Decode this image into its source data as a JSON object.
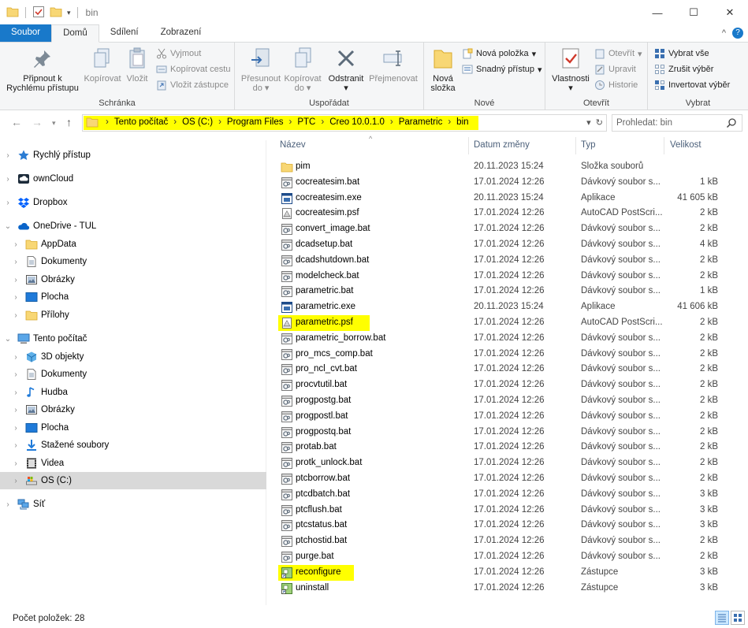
{
  "window": {
    "title": "bin"
  },
  "ribbon_tabs": [
    "Soubor",
    "Domů",
    "Sdílení",
    "Zobrazení"
  ],
  "ribbon": {
    "clipboard": {
      "label": "Schránka",
      "pin": "Připnout k Rychlému přístupu",
      "copy": "Kopírovat",
      "paste": "Vložit",
      "cut": "Vyjmout",
      "copy_path": "Kopírovat cestu",
      "paste_shortcut": "Vložit zástupce"
    },
    "organize": {
      "label": "Uspořádat",
      "move_to": "Přesunout do",
      "copy_to": "Kopírovat do",
      "delete": "Odstranit",
      "rename": "Přejmenovat"
    },
    "new": {
      "label": "Nové",
      "new_folder": "Nová složka",
      "new_item": "Nová položka",
      "easy_access": "Snadný přístup"
    },
    "open": {
      "label": "Otevřít",
      "properties": "Vlastnosti",
      "open": "Otevřít",
      "edit": "Upravit",
      "history": "Historie"
    },
    "select": {
      "label": "Vybrat",
      "select_all": "Vybrat vše",
      "select_none": "Zrušit výběr",
      "invert": "Invertovat výběr"
    }
  },
  "address": {
    "crumbs": [
      "Tento počítač",
      "OS (C:)",
      "Program Files",
      "PTC",
      "Creo 10.0.1.0",
      "Parametric",
      "bin"
    ],
    "search_placeholder": "Prohledat: bin"
  },
  "nav": [
    {
      "label": "Rychlý přístup",
      "icon": "star-icon",
      "indent": 0
    },
    {
      "label": "ownCloud",
      "icon": "cloud-icon",
      "indent": 0
    },
    {
      "label": "Dropbox",
      "icon": "dropbox-icon",
      "indent": 0
    },
    {
      "label": "OneDrive - TUL",
      "icon": "onedrive-icon",
      "indent": 0
    },
    {
      "label": "AppData",
      "icon": "folder-icon",
      "indent": 1
    },
    {
      "label": "Dokumenty",
      "icon": "document-icon",
      "indent": 1
    },
    {
      "label": "Obrázky",
      "icon": "pictures-icon",
      "indent": 1
    },
    {
      "label": "Plocha",
      "icon": "desktop-icon",
      "indent": 1
    },
    {
      "label": "Přílohy",
      "icon": "folder-icon",
      "indent": 1
    },
    {
      "label": "Tento počítač",
      "icon": "computer-icon",
      "indent": 0
    },
    {
      "label": "3D objekty",
      "icon": "cube-icon",
      "indent": 1
    },
    {
      "label": "Dokumenty",
      "icon": "document-icon",
      "indent": 1
    },
    {
      "label": "Hudba",
      "icon": "music-icon",
      "indent": 1
    },
    {
      "label": "Obrázky",
      "icon": "pictures-icon",
      "indent": 1
    },
    {
      "label": "Plocha",
      "icon": "desktop-icon",
      "indent": 1
    },
    {
      "label": "Stažené soubory",
      "icon": "download-icon",
      "indent": 1
    },
    {
      "label": "Videa",
      "icon": "video-icon",
      "indent": 1
    },
    {
      "label": "OS (C:)",
      "icon": "drive-icon",
      "indent": 1
    },
    {
      "label": "Síť",
      "icon": "network-icon",
      "indent": 0
    }
  ],
  "columns": {
    "name": "Název",
    "date": "Datum změny",
    "type": "Typ",
    "size": "Velikost"
  },
  "files": [
    {
      "name": "pim",
      "date": "20.11.2023 15:24",
      "type": "Složka souborů",
      "size": "",
      "icon": "folder-icon"
    },
    {
      "name": "cocreatesim.bat",
      "date": "17.01.2024 12:26",
      "type": "Dávkový soubor s...",
      "size": "1 kB",
      "icon": "bat-icon"
    },
    {
      "name": "cocreatesim.exe",
      "date": "20.11.2023 15:24",
      "type": "Aplikace",
      "size": "41 605 kB",
      "icon": "exe-icon"
    },
    {
      "name": "cocreatesim.psf",
      "date": "17.01.2024 12:26",
      "type": "AutoCAD PostScri...",
      "size": "2 kB",
      "icon": "psf-icon"
    },
    {
      "name": "convert_image.bat",
      "date": "17.01.2024 12:26",
      "type": "Dávkový soubor s...",
      "size": "2 kB",
      "icon": "bat-icon"
    },
    {
      "name": "dcadsetup.bat",
      "date": "17.01.2024 12:26",
      "type": "Dávkový soubor s...",
      "size": "4 kB",
      "icon": "bat-icon"
    },
    {
      "name": "dcadshutdown.bat",
      "date": "17.01.2024 12:26",
      "type": "Dávkový soubor s...",
      "size": "2 kB",
      "icon": "bat-icon"
    },
    {
      "name": "modelcheck.bat",
      "date": "17.01.2024 12:26",
      "type": "Dávkový soubor s...",
      "size": "2 kB",
      "icon": "bat-icon"
    },
    {
      "name": "parametric.bat",
      "date": "17.01.2024 12:26",
      "type": "Dávkový soubor s...",
      "size": "1 kB",
      "icon": "bat-icon"
    },
    {
      "name": "parametric.exe",
      "date": "20.11.2023 15:24",
      "type": "Aplikace",
      "size": "41 606 kB",
      "icon": "exe-icon"
    },
    {
      "name": "parametric.psf",
      "date": "17.01.2024 12:26",
      "type": "AutoCAD PostScri...",
      "size": "2 kB",
      "icon": "psf-icon",
      "highlight": true
    },
    {
      "name": "parametric_borrow.bat",
      "date": "17.01.2024 12:26",
      "type": "Dávkový soubor s...",
      "size": "2 kB",
      "icon": "bat-icon"
    },
    {
      "name": "pro_mcs_comp.bat",
      "date": "17.01.2024 12:26",
      "type": "Dávkový soubor s...",
      "size": "2 kB",
      "icon": "bat-icon"
    },
    {
      "name": "pro_ncl_cvt.bat",
      "date": "17.01.2024 12:26",
      "type": "Dávkový soubor s...",
      "size": "2 kB",
      "icon": "bat-icon"
    },
    {
      "name": "procvtutil.bat",
      "date": "17.01.2024 12:26",
      "type": "Dávkový soubor s...",
      "size": "2 kB",
      "icon": "bat-icon"
    },
    {
      "name": "progpostg.bat",
      "date": "17.01.2024 12:26",
      "type": "Dávkový soubor s...",
      "size": "2 kB",
      "icon": "bat-icon"
    },
    {
      "name": "progpostl.bat",
      "date": "17.01.2024 12:26",
      "type": "Dávkový soubor s...",
      "size": "2 kB",
      "icon": "bat-icon"
    },
    {
      "name": "progpostq.bat",
      "date": "17.01.2024 12:26",
      "type": "Dávkový soubor s...",
      "size": "2 kB",
      "icon": "bat-icon"
    },
    {
      "name": "protab.bat",
      "date": "17.01.2024 12:26",
      "type": "Dávkový soubor s...",
      "size": "2 kB",
      "icon": "bat-icon"
    },
    {
      "name": "protk_unlock.bat",
      "date": "17.01.2024 12:26",
      "type": "Dávkový soubor s...",
      "size": "2 kB",
      "icon": "bat-icon"
    },
    {
      "name": "ptcborrow.bat",
      "date": "17.01.2024 12:26",
      "type": "Dávkový soubor s...",
      "size": "2 kB",
      "icon": "bat-icon"
    },
    {
      "name": "ptcdbatch.bat",
      "date": "17.01.2024 12:26",
      "type": "Dávkový soubor s...",
      "size": "3 kB",
      "icon": "bat-icon"
    },
    {
      "name": "ptcflush.bat",
      "date": "17.01.2024 12:26",
      "type": "Dávkový soubor s...",
      "size": "3 kB",
      "icon": "bat-icon"
    },
    {
      "name": "ptcstatus.bat",
      "date": "17.01.2024 12:26",
      "type": "Dávkový soubor s...",
      "size": "3 kB",
      "icon": "bat-icon"
    },
    {
      "name": "ptchostid.bat",
      "date": "17.01.2024 12:26",
      "type": "Dávkový soubor s...",
      "size": "2 kB",
      "icon": "bat-icon"
    },
    {
      "name": "purge.bat",
      "date": "17.01.2024 12:26",
      "type": "Dávkový soubor s...",
      "size": "2 kB",
      "icon": "bat-icon"
    },
    {
      "name": "reconfigure",
      "date": "17.01.2024 12:26",
      "type": "Zástupce",
      "size": "3 kB",
      "icon": "shortcut-icon",
      "highlight": true
    },
    {
      "name": "uninstall",
      "date": "17.01.2024 12:26",
      "type": "Zástupce",
      "size": "3 kB",
      "icon": "shortcut-icon"
    }
  ],
  "status": {
    "count": "Počet položek: 28"
  },
  "colors": {
    "accent": "#1979ca",
    "highlight": "#ffff00",
    "folder": "#f8d775"
  }
}
